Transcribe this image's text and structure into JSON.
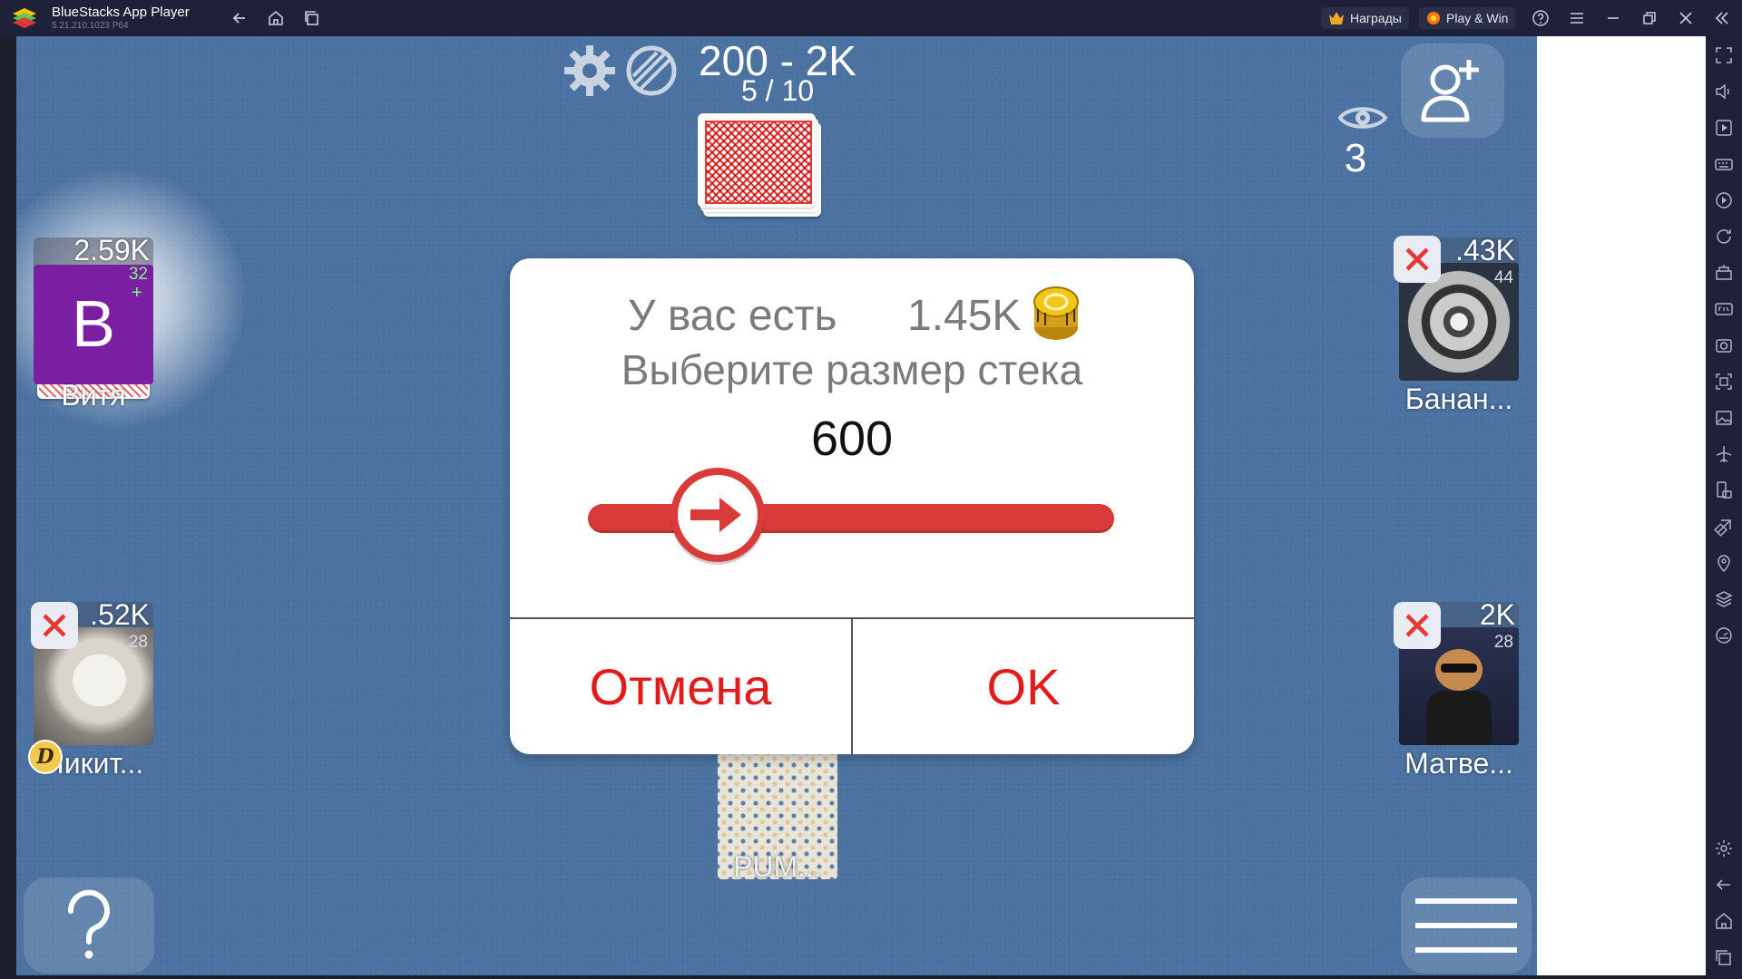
{
  "titlebar": {
    "app_name": "BlueStacks App Player",
    "version": "5.21.210.1023  P64",
    "rewards_label": "Награды",
    "play_win_label": "Play & Win"
  },
  "table": {
    "stakes": "200 - 2K",
    "round": "5 / 10",
    "spectators": "3"
  },
  "players": [
    {
      "name": "Витя",
      "chips": "2.59K",
      "level": "32",
      "avatar_letter": "В",
      "avatar_color": "#7b1fa2"
    },
    {
      "name": "Банан...",
      "chips": ".43K",
      "level": "44"
    },
    {
      "name": "Никит...",
      "chips": ".52K",
      "level": "28"
    },
    {
      "name": "Матве...",
      "chips": "2K",
      "level": "28"
    },
    {
      "name": "PUM..."
    }
  ],
  "dialog": {
    "have_label": "У вас есть",
    "have_amount": "1.45K",
    "title": "Выберите размер стека",
    "value": "600",
    "slider_level": 0.25,
    "cancel_label": "Отмена",
    "ok_label": "OK"
  },
  "colors": {
    "table_bg": "#4b72a0",
    "accent_red": "#e31b1b",
    "slider_red": "#d93b3b",
    "chrome_bg": "#1e2138"
  }
}
